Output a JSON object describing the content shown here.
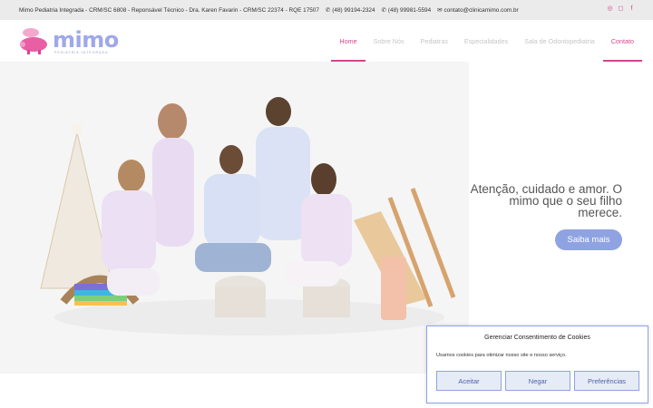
{
  "topbar": {
    "clinic_info": "Mimo Pediatria Integrada - CRM/SC 6808 - Reponsável Técnico - Dra. Karen Favarin - CRM/SC 22374 - RQE 17507",
    "phone1": "(48) 99194-2324",
    "phone2": "(48) 99981-5594",
    "email": "contato@clinicamimo.com.br",
    "social_icons": [
      "whatsapp-icon",
      "instagram-icon",
      "facebook-icon"
    ]
  },
  "logo": {
    "word": "mimo",
    "sub": "PEDIATRIA INTEGRADA"
  },
  "nav": {
    "items": [
      {
        "label": "Home"
      },
      {
        "label": "Sobre Nós"
      },
      {
        "label": "Pediatras"
      },
      {
        "label": "Especialidades"
      },
      {
        "label": "Sala de Odontopediatria"
      },
      {
        "label": "Contato"
      }
    ]
  },
  "hero": {
    "tagline": "Atenção, cuidado e amor. O mimo que o seu filho merece.",
    "cta": "Saiba mais"
  },
  "cookie": {
    "title": "Gerenciar Consentimento de Cookies",
    "text": "Usamos cookies para otimizar nosso site e nosso serviço.",
    "accept": "Aceitar",
    "deny": "Negar",
    "prefs": "Preferências"
  },
  "colors": {
    "accent": "#d6448f",
    "button_blue": "#8fa3e2",
    "logo_blue": "#9fa8e8",
    "topbar_bg": "#ebebeb"
  }
}
